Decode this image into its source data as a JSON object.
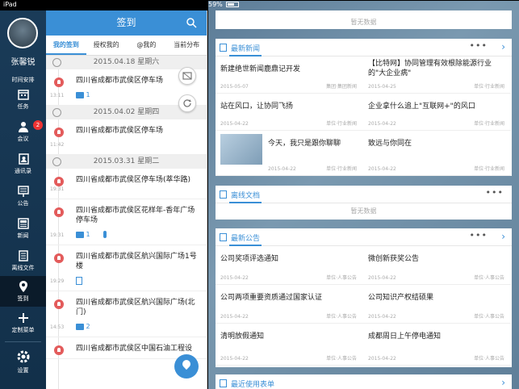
{
  "statusbar": {
    "carrier": "iPad",
    "time": "下午4:34",
    "battery": "59%"
  },
  "sidebar": {
    "username": "张馨锐",
    "time_label": "时间安排",
    "items": [
      {
        "label": "任务",
        "icon": "calendar-icon"
      },
      {
        "label": "会议",
        "icon": "meeting-icon",
        "badge": "2"
      },
      {
        "label": "通讯录",
        "icon": "contacts-icon"
      },
      {
        "label": "公告",
        "icon": "announcement-icon"
      },
      {
        "label": "新闻",
        "icon": "news-icon"
      },
      {
        "label": "离线文件",
        "icon": "files-icon"
      },
      {
        "label": "签到",
        "icon": "location-pin-icon",
        "active": true
      },
      {
        "label": "定制菜单",
        "icon": "plus-icon"
      },
      {
        "label": "设置",
        "icon": "gear-icon"
      }
    ]
  },
  "checkin": {
    "title": "签到",
    "tabs": [
      "我的签到",
      "授权我的",
      "@我的",
      "当前分布"
    ],
    "groups": [
      {
        "date": "2015.04.18 星期六",
        "entries": [
          {
            "place": "四川省成都市武侯区停车场",
            "time": "13:11",
            "photos": "1"
          }
        ]
      },
      {
        "date": "2015.04.02 星期四",
        "entries": [
          {
            "place": "四川省成都市武侯区停车场",
            "time": "11:42"
          }
        ]
      },
      {
        "date": "2015.03.31 星期二",
        "entries": [
          {
            "place": "四川省成都市武侯区停车场(萃华路)",
            "time": "19:31"
          },
          {
            "place": "四川省成都市武侯区花样年-香年广场停车场",
            "time": "19:31",
            "photos": "1"
          },
          {
            "place": "四川省成都市武侯区航兴国际广场1号楼",
            "time": "19:29"
          },
          {
            "place": "四川省成都市武侯区航兴国际广场(北门)",
            "time": "14:53",
            "photos": "2"
          },
          {
            "place": "四川省成都市武侯区中国石油工程设",
            "time": ""
          }
        ]
      }
    ]
  },
  "panels": {
    "top_empty": "暂无数据",
    "news": {
      "title": "最新新闻",
      "items": [
        {
          "title": "新建绝世新闻鹿鼎记开发",
          "date": "2015-05-07",
          "source": "集团·集团新闻"
        },
        {
          "title": "【比特网】协同管理有效根除能源行业的\"大企业病\"",
          "date": "2015-04-25",
          "source": "单位·行业新闻"
        },
        {
          "title": "站在风口，让协同飞扬",
          "date": "2015-04-22",
          "source": "单位·行业新闻"
        },
        {
          "title": "企业拿什么追上\"互联网+\"的风口",
          "date": "2015-04-22",
          "source": "单位·行业新闻"
        },
        {
          "title": "今天，我只是跟你聊聊",
          "date": "2015-04-22",
          "source": "单位·行业新闻"
        },
        {
          "title": "致远与你同在",
          "date": "2015-04-22",
          "source": "单位·行业新闻"
        }
      ]
    },
    "offline": {
      "title": "离线文档",
      "empty": "暂无数据"
    },
    "notices": {
      "title": "最新公告",
      "items": [
        {
          "title": "公司奖项评选通知",
          "date": "2015-04-22",
          "source": "单位·人事公告"
        },
        {
          "title": "微创新获奖公告",
          "date": "2015-04-22",
          "source": "单位·人事公告"
        },
        {
          "title": "公司两项重要资质通过国家认证",
          "date": "2015-04-22",
          "source": "单位·人事公告"
        },
        {
          "title": "公司知识产权结硕果",
          "date": "2015-04-22",
          "source": "单位·人事公告"
        },
        {
          "title": "清明放假通知",
          "date": "2015-04-22",
          "source": "单位·人事公告"
        },
        {
          "title": "成都周日上午停电通知",
          "date": "2015-04-22",
          "source": "单位·人事公告"
        }
      ]
    },
    "recent_forms": {
      "title": "最近使用表单"
    },
    "more": "•••",
    "arrow": "›"
  }
}
